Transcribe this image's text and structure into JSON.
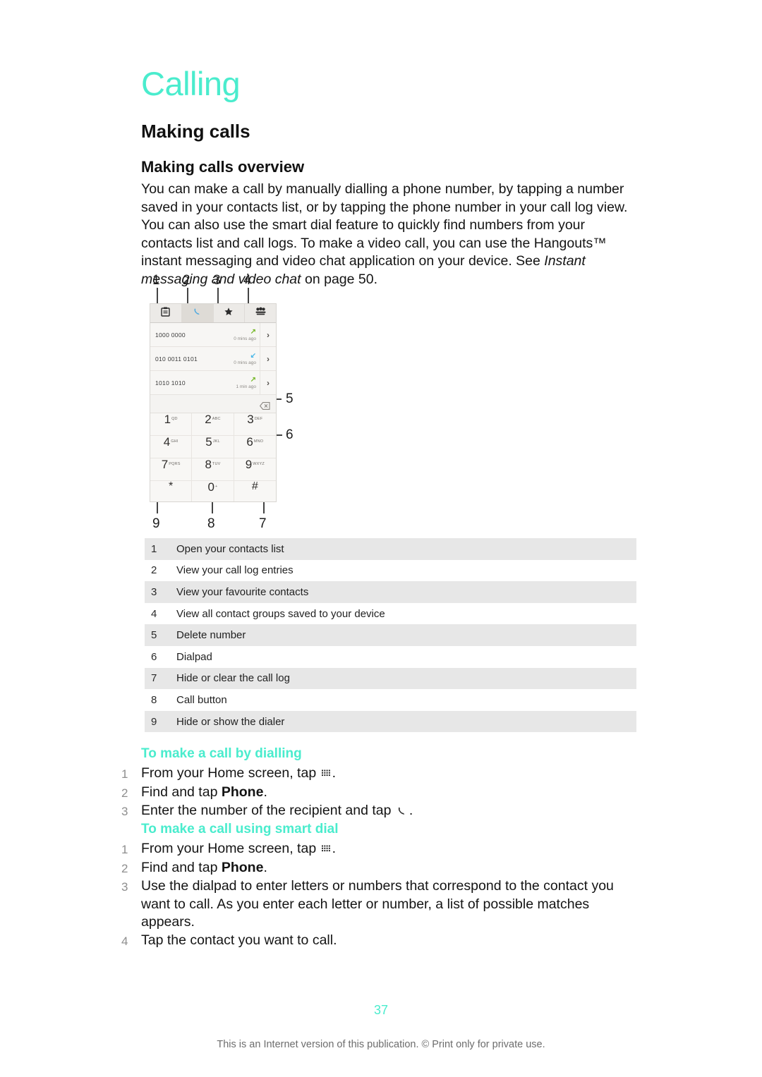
{
  "chapter": {
    "title": "Calling"
  },
  "headings": {
    "h1": "Making calls",
    "h2": "Making calls overview"
  },
  "intro": {
    "part1": "You can make a call by manually dialling a phone number, by tapping a number saved in your contacts list, or by tapping the phone number in your call log view. You can also use the smart dial feature to quickly find numbers from your contacts list and call logs. To make a video call, you can use the Hangouts™ instant messaging and video chat application on your device. See ",
    "italic": "Instant messaging and video chat",
    "part2": " on page 50."
  },
  "figure": {
    "callouts": [
      "1",
      "2",
      "3",
      "4",
      "5",
      "6",
      "7",
      "8",
      "9"
    ],
    "tabs": [
      {
        "name": "contacts-tab",
        "icon": "contacts-icon",
        "glyph": "ὌB"
      },
      {
        "name": "call-log-tab",
        "icon": "phone-handset-icon",
        "glyph": "phone"
      },
      {
        "name": "favourites-tab",
        "icon": "star-icon",
        "glyph": "★"
      },
      {
        "name": "groups-tab",
        "icon": "groups-icon",
        "glyph": "people"
      }
    ],
    "call_log": [
      {
        "number": "1000 0000",
        "direction": "outgoing",
        "arrow": "↗",
        "time": "0 mins ago"
      },
      {
        "number": "010 0011 0101",
        "direction": "incoming",
        "arrow": "↙",
        "time": "0 mins ago"
      },
      {
        "number": "1010 1010",
        "direction": "outgoing",
        "arrow": "↗",
        "time": "1 min ago"
      }
    ],
    "keypad": [
      {
        "digit": "1",
        "letters": "QD"
      },
      {
        "digit": "2",
        "letters": "ABC"
      },
      {
        "digit": "3",
        "letters": "DEF"
      },
      {
        "digit": "4",
        "letters": "GHI"
      },
      {
        "digit": "5",
        "letters": "JKL"
      },
      {
        "digit": "6",
        "letters": "MNO"
      },
      {
        "digit": "7",
        "letters": "PQRS"
      },
      {
        "digit": "8",
        "letters": "TUV"
      },
      {
        "digit": "9",
        "letters": "WXYZ"
      },
      {
        "digit": "*",
        "letters": ""
      },
      {
        "digit": "0",
        "letters": "+"
      },
      {
        "digit": "#",
        "letters": ""
      }
    ],
    "colors": {
      "call_button": "#a8cd37",
      "outgoing_arrow": "#76b82a",
      "incoming_arrow": "#49b6e8"
    }
  },
  "legend": {
    "rows": [
      {
        "num": "1",
        "text": "Open your contacts list"
      },
      {
        "num": "2",
        "text": "View your call log entries"
      },
      {
        "num": "3",
        "text": "View your favourite contacts"
      },
      {
        "num": "4",
        "text": "View all contact groups saved to your device"
      },
      {
        "num": "5",
        "text": "Delete number"
      },
      {
        "num": "6",
        "text": "Dialpad"
      },
      {
        "num": "7",
        "text": "Hide or clear the call log"
      },
      {
        "num": "8",
        "text": "Call button"
      },
      {
        "num": "9",
        "text": "Hide or show the dialer"
      }
    ]
  },
  "procedures": [
    {
      "title": "To make a call by dialling",
      "steps": [
        {
          "num": "1",
          "pre": "From your Home screen, tap ",
          "icon": "app-grid-icon",
          "post": "."
        },
        {
          "num": "2",
          "pre": "Find and tap ",
          "bold": "Phone",
          "post": "."
        },
        {
          "num": "3",
          "pre": "Enter the number of the recipient and tap ",
          "icon": "phone-handset-icon",
          "post": "."
        }
      ]
    },
    {
      "title": "To make a call using smart dial",
      "steps": [
        {
          "num": "1",
          "pre": "From your Home screen, tap ",
          "icon": "app-grid-icon",
          "post": "."
        },
        {
          "num": "2",
          "pre": "Find and tap ",
          "bold": "Phone",
          "post": "."
        },
        {
          "num": "3",
          "pre": "Use the dialpad to enter letters or numbers that correspond to the contact you want to call. As you enter each letter or number, a list of possible matches appears.",
          "post": ""
        },
        {
          "num": "4",
          "pre": "Tap the contact you want to call.",
          "post": ""
        }
      ]
    }
  ],
  "footer": {
    "page_number": "37",
    "note": "This is an Internet version of this publication. © Print only for private use."
  },
  "theme": {
    "accent": "#4aeccd",
    "shade_row": "#e7e7e7"
  }
}
